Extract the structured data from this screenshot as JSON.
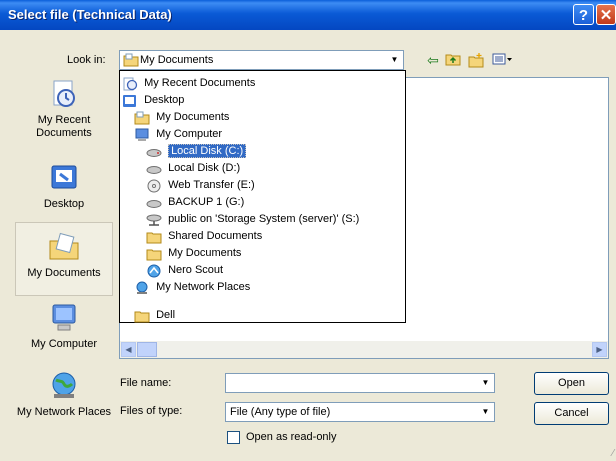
{
  "window": {
    "title": "Select file (Technical Data)"
  },
  "lookin": {
    "label": "Look in:",
    "value": "My Documents"
  },
  "toolbar": {
    "back_icon": "back-arrow-icon",
    "up_icon": "up-folder-icon",
    "new_folder_icon": "new-folder-icon",
    "views_icon": "views-menu-icon"
  },
  "places": [
    {
      "label": "My Recent Documents",
      "icon": "recent-documents-icon"
    },
    {
      "label": "Desktop",
      "icon": "desktop-icon"
    },
    {
      "label": "My Documents",
      "icon": "my-documents-icon",
      "selected": true
    },
    {
      "label": "My Computer",
      "icon": "my-computer-icon"
    },
    {
      "label": "My Network Places",
      "icon": "network-places-icon"
    }
  ],
  "dropdown": {
    "items": [
      {
        "label": "My Recent Documents",
        "icon": "recent-documents-icon"
      },
      {
        "label": "Desktop",
        "icon": "desktop-icon"
      },
      {
        "label": "My Documents",
        "icon": "folder-icon"
      },
      {
        "label": "My Computer",
        "icon": "computer-icon"
      },
      {
        "label": "Local Disk (C:)",
        "icon": "hard-drive-icon",
        "selected": true
      },
      {
        "label": "Local Disk (D:)",
        "icon": "hard-drive-icon"
      },
      {
        "label": "Web Transfer (E:)",
        "icon": "cd-drive-icon"
      },
      {
        "label": "BACKUP 1 (G:)",
        "icon": "hard-drive-icon"
      },
      {
        "label": "public on 'Storage System (server)' (S:)",
        "icon": "network-drive-icon"
      },
      {
        "label": "Shared Documents",
        "icon": "folder-icon"
      },
      {
        "label": "My Documents",
        "icon": "folder-icon"
      },
      {
        "label": "Nero Scout",
        "icon": "nero-scout-icon"
      },
      {
        "label": "My Network Places",
        "icon": "network-places-icon"
      }
    ]
  },
  "filelist": {
    "items": [
      {
        "label": "Dell",
        "icon": "folder-icon"
      }
    ]
  },
  "filename": {
    "label": "File name:",
    "value": ""
  },
  "filetype": {
    "label": "Files of type:",
    "value": "File (Any type of file)"
  },
  "readonly": {
    "label": "Open as read-only",
    "checked": false
  },
  "buttons": {
    "open": "Open",
    "cancel": "Cancel"
  }
}
